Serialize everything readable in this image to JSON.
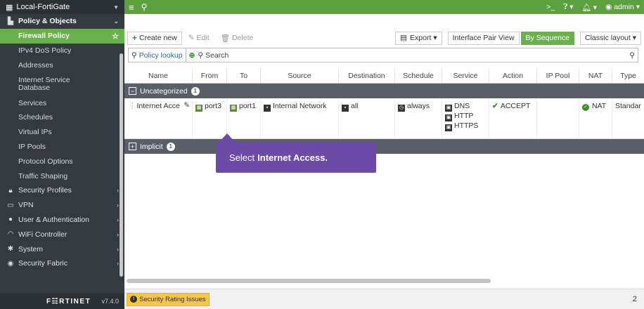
{
  "sidebar": {
    "device": "Local-FortiGate",
    "section": "Policy & Objects",
    "items": {
      "firewall_policy": "Firewall Policy",
      "ipv4_dos": "IPv4 DoS Policy",
      "addresses": "Addresses",
      "isdb": "Internet Service Database",
      "services": "Services",
      "schedules": "Schedules",
      "vips": "Virtual IPs",
      "ip_pools": "IP Pools",
      "protocol_options": "Protocol Options",
      "traffic_shaping": "Traffic Shaping"
    },
    "groups": {
      "security_profiles": "Security Profiles",
      "vpn": "VPN",
      "user_auth": "User & Authentication",
      "wifi": "WiFi Controller",
      "system": "System",
      "fabric": "Security Fabric"
    },
    "logo": "F☷RTINET",
    "version": "v7.4.0"
  },
  "topbar": {
    "user": "admin"
  },
  "toolbar": {
    "create": "Create new",
    "edit": "Edit",
    "delete": "Delete",
    "export": "Export",
    "interface_pair": "Interface Pair View",
    "by_sequence": "By Sequence",
    "classic": "Classic layout"
  },
  "search": {
    "lookup": "Policy lookup",
    "placeholder": "Search"
  },
  "table": {
    "columns": {
      "name": "Name",
      "from": "From",
      "to": "To",
      "source": "Source",
      "destination": "Destination",
      "schedule": "Schedule",
      "service": "Service",
      "action": "Action",
      "ippool": "IP Pool",
      "nat": "NAT",
      "type": "Type"
    },
    "group1": {
      "label": "Uncategorized",
      "count": "1"
    },
    "row": {
      "name": "Internet Acce",
      "from": "port3",
      "to": "port1",
      "source": "Internal Network",
      "destination": "all",
      "schedule": "always",
      "services": [
        "DNS",
        "HTTP",
        "HTTPS"
      ],
      "action": "ACCEPT",
      "nat": "NAT",
      "type": "Standar"
    },
    "group2": {
      "label": "Implicit",
      "count": "1"
    }
  },
  "tooltip": {
    "prefix": "Select",
    "target": "Internet Access."
  },
  "status": {
    "badge": "Security Rating Issues",
    "count": "2"
  }
}
